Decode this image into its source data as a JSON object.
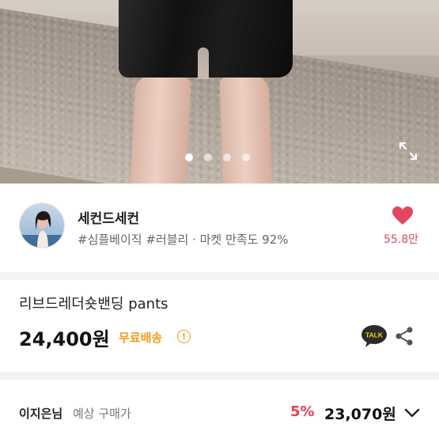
{
  "carousel": {
    "total_dots": 4,
    "active_index": 0
  },
  "icons": {
    "expand": "expand-icon",
    "heart": "heart-icon",
    "talk": "kakaotalk-icon",
    "share": "share-icon",
    "info": "info-icon",
    "chevron": "chevron-down-icon"
  },
  "shop": {
    "name": "세컨드세컨",
    "tags": "#심플베이직 #러블리 · 마켓 만족도 92%",
    "like_count": "55.8만"
  },
  "product": {
    "title": "리브드레더숏밴딩 pants",
    "price": "24,400원",
    "shipping": "무료배송",
    "info_symbol": "!",
    "talk_label": "TALK"
  },
  "buyer": {
    "name": "이지은님",
    "label": "예상 구매가",
    "discount": "5%",
    "expected_price": "23,070원"
  },
  "colors": {
    "accent_pink": "#e2475d",
    "discount_red": "#ec3d57",
    "shipping_orange": "#f29d1d"
  }
}
